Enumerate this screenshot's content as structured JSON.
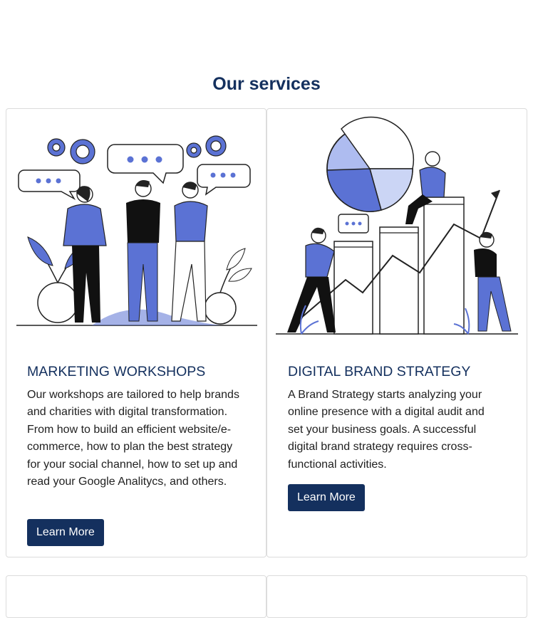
{
  "section": {
    "title": "Our services"
  },
  "cards": [
    {
      "title": "MARKETING WORKSHOPS",
      "text": "Our workshops are tailored to help brands and charities with digital transformation. From how to build an efficient website/e-commerce, how to plan the best strategy for your social channel, how to set up and read your Google Analitycs, and others.",
      "button": "Learn More",
      "image": "team-discussion-illustration"
    },
    {
      "title": "DIGITAL BRAND STRATEGY",
      "text": "A Brand Strategy starts analyzing your online presence with a digital audit and set your business goals. A successful digital brand strategy requires cross-functional activities.",
      "button": "Learn More",
      "image": "growth-chart-illustration"
    }
  ],
  "colors": {
    "accent": "#14305e",
    "illustration": "#5b72d4",
    "illustration_light": "#aebcf0"
  }
}
